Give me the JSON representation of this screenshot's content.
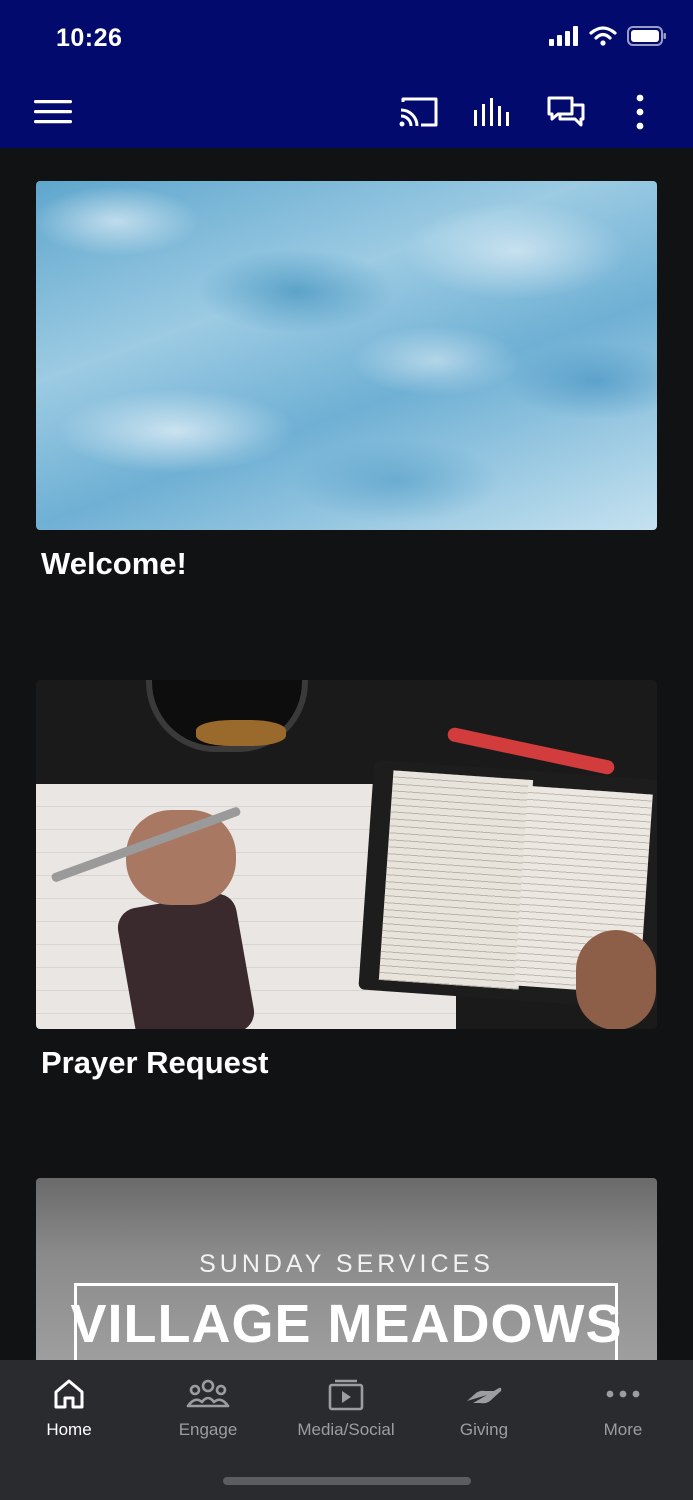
{
  "status_bar": {
    "time": "10:26"
  },
  "header": {
    "menu_icon": "hamburger-menu-icon",
    "actions": [
      "cast-icon",
      "audio-bars-icon",
      "chat-icon",
      "more-vertical-icon"
    ]
  },
  "cards": [
    {
      "title": "Welcome!",
      "image": "water-surface"
    },
    {
      "title": "Prayer Request",
      "image": "bible-notebook-desk"
    },
    {
      "title": "",
      "image": "sunday-services-banner",
      "overlay_sub": "SUNDAY SERVICES",
      "overlay_main": "VILLAGE MEADOWS"
    }
  ],
  "tabbar": {
    "tabs": [
      {
        "label": "Home",
        "icon": "home-icon",
        "active": true
      },
      {
        "label": "Engage",
        "icon": "people-group-icon",
        "active": false
      },
      {
        "label": "Media/Social",
        "icon": "media-play-icon",
        "active": false
      },
      {
        "label": "Giving",
        "icon": "giving-hand-icon",
        "active": false
      },
      {
        "label": "More",
        "icon": "more-horizontal-icon",
        "active": false
      }
    ]
  },
  "colors": {
    "header_bg": "#020a6e",
    "page_bg": "#111214",
    "tabbar_bg": "#2a2b2e"
  }
}
